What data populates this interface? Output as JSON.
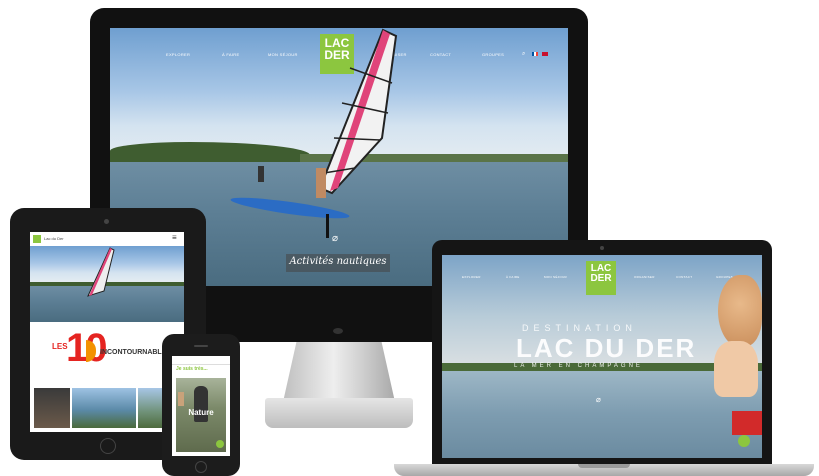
{
  "imac": {
    "nav_left": [
      "EXPLORER",
      "À FAIRE",
      "MON SÉJOUR"
    ],
    "nav_right": [
      "ORGANISER",
      "CONTACT",
      "GROUPES"
    ],
    "logo_line1": "LAC",
    "logo_line2": "DER",
    "caption": "Activités nautiques"
  },
  "tablet": {
    "header_label": "Lac du Der",
    "les": "LES",
    "number": "10",
    "incontournables": "INCONTOURNABLES"
  },
  "phone": {
    "header_text": "Je suis très...",
    "card_label": "Nature"
  },
  "laptop": {
    "nav_left": [
      "EXPLORER",
      "À FAIRE",
      "MON SÉJOUR"
    ],
    "nav_right": [
      "ORGANISER",
      "CONTACT",
      "GROUPES"
    ],
    "logo_line1": "LAC",
    "logo_line2": "DER",
    "subtitle_top": "DESTINATION",
    "title": "LAC DU DER",
    "subtitle_bottom": "LA MER EN CHAMPAGNE"
  },
  "colors": {
    "brand_green": "#8cc63f",
    "accent_red": "#e52421",
    "accent_orange": "#f39200"
  }
}
